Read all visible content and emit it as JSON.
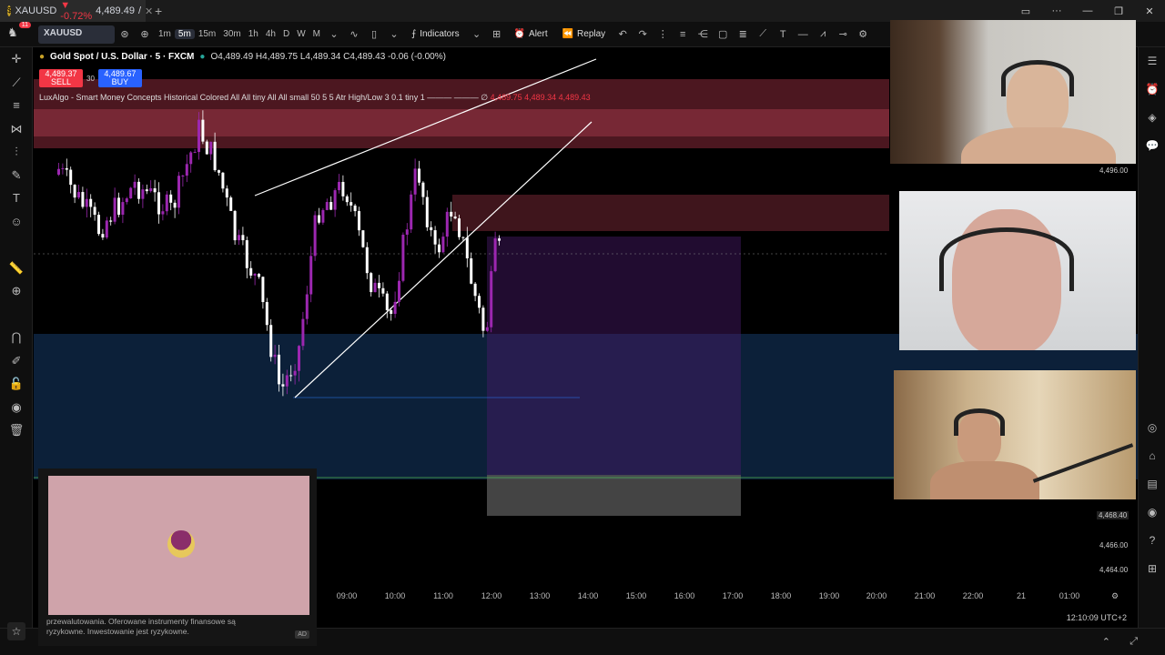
{
  "browser": {
    "tab_symbol": "XAUUSD",
    "tab_price": "4,489.49",
    "tab_change": "▼ -0.72%",
    "tab_suffix": "/",
    "new_tab": "+"
  },
  "toolbar": {
    "notifications": "11",
    "symbol": "XAUUSD",
    "timeframes": [
      "1m",
      "5m",
      "15m",
      "30m",
      "1h",
      "4h",
      "D",
      "W",
      "M"
    ],
    "active_timeframe": "5m",
    "indicators_label": "Indicators",
    "alert_label": "Alert",
    "replay_label": "Replay"
  },
  "chart": {
    "instrument": "Gold Spot / U.S. Dollar · 5 · FXCM",
    "ohlc": "O4,489.49 H4,489.75 L4,489.34 C4,489.43 -0.06 (-0.00%)",
    "sell_price": "4,489.37",
    "sell_label": "SELL",
    "spread": "30",
    "buy_price": "4,489.67",
    "buy_label": "BUY",
    "indicator_name": "LuxAlgo - Smart Money Concepts Historical Colored All All tiny All All small 50 5 5 Atr High/Low 3 0.1 tiny 1 ——— ——— ∅",
    "indicator_values": "4,489.75 4,489.34 4,489.43",
    "price_labels": [
      "4,496.00",
      "4,468.40",
      "4,466.00",
      "4,464.00"
    ],
    "time_labels": [
      "09:00",
      "10:00",
      "11:00",
      "12:00",
      "13:00",
      "14:00",
      "15:00",
      "16:00",
      "17:00",
      "18:00",
      "19:00",
      "20:00",
      "21:00",
      "22:00",
      "21",
      "01:00"
    ],
    "clock": "12:10:09 UTC+2"
  },
  "ad": {
    "text_line1": "przewalutowania. Oferowane instrumenty finansowe są",
    "text_line2": "ryzykowne. Inwestowanie jest ryzykowne.",
    "tag": "AD"
  },
  "colors": {
    "bull": "#9c27b0",
    "bear": "#ffffff",
    "supply": "#8b2a3a",
    "demand": "#1e4f8f",
    "sell": "#f23645",
    "buy": "#2962ff"
  }
}
